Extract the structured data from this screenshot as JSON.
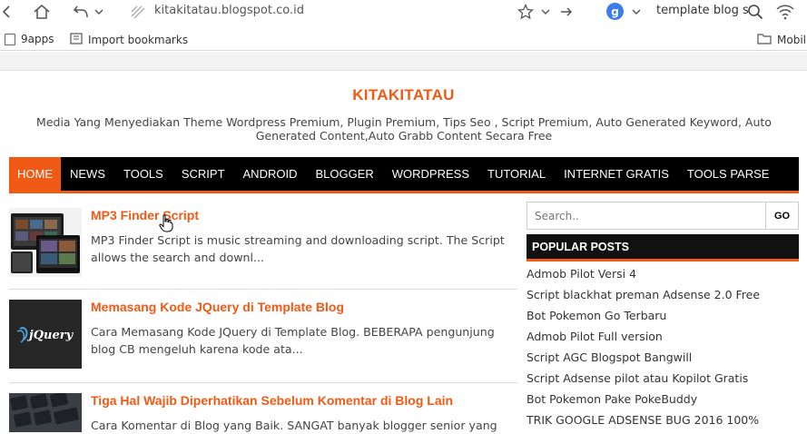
{
  "browser": {
    "url": "kitakitatau.blogspot.co.id",
    "search_text": "template blog s",
    "search_engine_letter": "g",
    "bookmarks": [
      {
        "label": "9apps"
      },
      {
        "label": "Import bookmarks"
      },
      {
        "label": "Mobil"
      }
    ]
  },
  "site": {
    "title": "KITAKITATAU",
    "description": "Media Yang Menyediakan Theme Wordpress Premium, Plugin Premium, Tips Seo , Script Premium, Auto Generated Keyword, Auto Generated Content,Auto Grabb Content Secara Free",
    "accent": "#f05a14"
  },
  "nav": {
    "items": [
      "HOME",
      "NEWS",
      "TOOLS",
      "SCRIPT",
      "ANDROID",
      "BLOGGER",
      "WORDPRESS",
      "TUTORIAL",
      "INTERNET GRATIS",
      "TOOLS PARSE"
    ]
  },
  "posts": [
    {
      "title": "MP3 Finder Script",
      "excerpt": "MP3 Finder Script is music streaming and downloading script. The Script allows the search and downl..."
    },
    {
      "title": "Memasang Kode JQuery di Template Blog",
      "excerpt": "Cara Memasang Kode JQuery di Template Blog. BEBERAPA pengunjung blog CB mengeluh karena kode ata...",
      "thumb_text": "jQuery"
    },
    {
      "title": "Tiga Hal Wajib Diperhatikan Sebelum Komentar di Blog Lain",
      "excerpt": "Cara Komentar di Blog yang Baik. SANGAT banyak blogger senior yang"
    }
  ],
  "sidebar": {
    "search_placeholder": "Search..",
    "go_label": "GO",
    "popular_header": "POPULAR POSTS",
    "popular_posts": [
      "Admob Pilot Versi 4",
      "Script blackhat preman Adsense 2.0 Free",
      "Bot Pokemon Go Terbaru",
      "Admob Pilot Full version",
      "Script AGC Blogspot Bangwill",
      "Script Adsense pilot atau Kopilot Gratis",
      "Bot Pokemon Pake PokeBuddy",
      "TRIK GOOGLE ADSENSE BUG 2016 100%"
    ]
  }
}
